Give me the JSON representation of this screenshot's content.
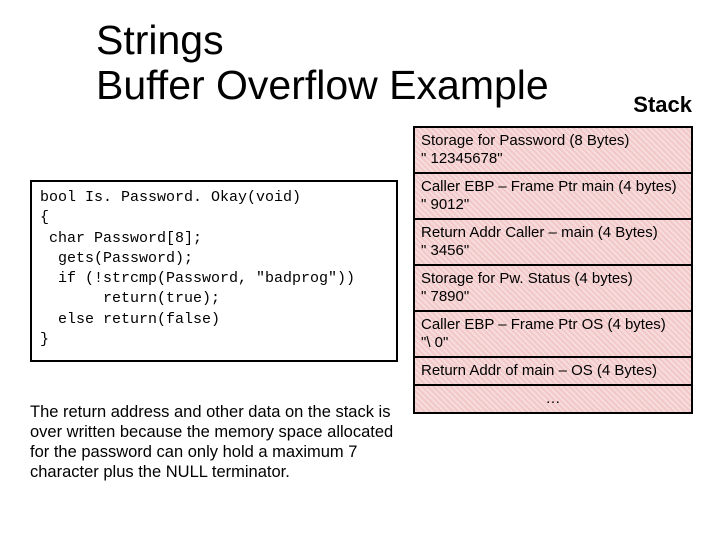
{
  "title_line1": "Strings",
  "title_line2": "Buffer Overflow Example",
  "stack_label": "Stack",
  "code": {
    "l1": "bool Is. Password. Okay(void)",
    "l2": "{",
    "l3": " char Password[8];",
    "l4": "",
    "l5": "  gets(Password);",
    "l6": "  if (!strcmp(Password, \"badprog\"))",
    "l7": "       return(true);",
    "l8": "  else return(false)",
    "l9": "}"
  },
  "explain": "The return address and other data on the stack is over written because the memory space allocated for the password can only hold a maximum 7 character plus the NULL terminator.",
  "stack": [
    {
      "label": "Storage for Password (8 Bytes)",
      "value": "\" 12345678\""
    },
    {
      "label": "Caller EBP – Frame Ptr main (4 bytes)",
      "value": "\" 9012\""
    },
    {
      "label": "Return Addr Caller – main (4 Bytes)",
      "value": "\" 3456\""
    },
    {
      "label": "Storage for Pw. Status (4 bytes)",
      "value": "\" 7890\""
    },
    {
      "label": "Caller EBP – Frame Ptr OS (4 bytes)",
      "value": "\"\\ 0\""
    },
    {
      "label": "Return Addr of main – OS (4 Bytes)",
      "value": ""
    },
    {
      "label": "…",
      "value": ""
    }
  ]
}
